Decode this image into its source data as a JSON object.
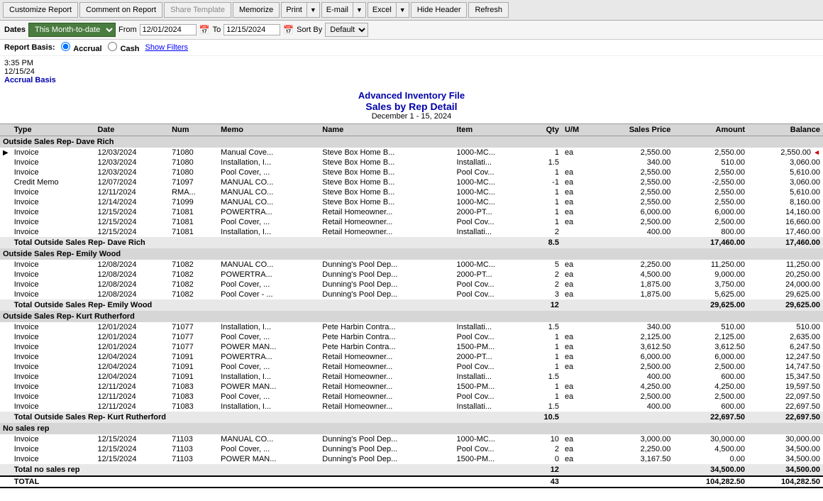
{
  "toolbar": {
    "customize_report": "Customize Report",
    "comment_on_report": "Comment on Report",
    "share_template": "Share Template",
    "memorize": "Memorize",
    "print": "Print",
    "email": "E-mail",
    "excel": "Excel",
    "hide_header": "Hide Header",
    "refresh": "Refresh"
  },
  "filter_bar": {
    "dates_label": "Dates",
    "date_range": "This Month-to-date",
    "from_label": "From",
    "from_date": "12/01/2024",
    "to_label": "To",
    "to_date": "12/15/2024",
    "sort_label": "Sort By",
    "sort_value": "Default"
  },
  "basis_bar": {
    "report_basis_label": "Report Basis:",
    "accrual_label": "Accrual",
    "cash_label": "Cash",
    "show_filters": "Show Filters"
  },
  "meta": {
    "time": "3:35 PM",
    "date": "12/15/24",
    "basis": "Accrual Basis"
  },
  "report_header": {
    "company": "Advanced Inventory File",
    "title": "Sales by Rep Detail",
    "dates": "December 1 - 15, 2024"
  },
  "columns": [
    "Type",
    "Date",
    "Num",
    "Memo",
    "Name",
    "Item",
    "Qty",
    "U/M",
    "Sales Price",
    "Amount",
    "Balance"
  ],
  "groups": [
    {
      "label": "Outside Sales Rep- Dave Rich",
      "rows": [
        {
          "type": "Invoice",
          "date": "12/03/2024",
          "num": "71080",
          "memo": "Manual Cove...",
          "name": "Steve Box Home B...",
          "item": "1000-MC...",
          "qty": "1",
          "um": "ea",
          "price": "2,550.00",
          "amount": "2,550.00",
          "balance": "2,550.00",
          "note": "◄"
        },
        {
          "type": "Invoice",
          "date": "12/03/2024",
          "num": "71080",
          "memo": "Installation, I...",
          "name": "Steve Box Home B...",
          "item": "Installati...",
          "qty": "1.5",
          "um": "",
          "price": "340.00",
          "amount": "510.00",
          "balance": "3,060.00",
          "note": ""
        },
        {
          "type": "Invoice",
          "date": "12/03/2024",
          "num": "71080",
          "memo": "Pool Cover, ...",
          "name": "Steve Box Home B...",
          "item": "Pool Cov...",
          "qty": "1",
          "um": "ea",
          "price": "2,550.00",
          "amount": "2,550.00",
          "balance": "5,610.00",
          "note": ""
        },
        {
          "type": "Credit Memo",
          "date": "12/07/2024",
          "num": "71097",
          "memo": "MANUAL CO...",
          "name": "Steve Box Home B...",
          "item": "1000-MC...",
          "qty": "-1",
          "um": "ea",
          "price": "2,550.00",
          "amount": "-2,550.00",
          "balance": "3,060.00",
          "note": ""
        },
        {
          "type": "Invoice",
          "date": "12/11/2024",
          "num": "RMA...",
          "memo": "MANUAL CO...",
          "name": "Steve Box Home B...",
          "item": "1000-MC...",
          "qty": "1",
          "um": "ea",
          "price": "2,550.00",
          "amount": "2,550.00",
          "balance": "5,610.00",
          "note": ""
        },
        {
          "type": "Invoice",
          "date": "12/14/2024",
          "num": "71099",
          "memo": "MANUAL CO...",
          "name": "Steve Box Home B...",
          "item": "1000-MC...",
          "qty": "1",
          "um": "ea",
          "price": "2,550.00",
          "amount": "2,550.00",
          "balance": "8,160.00",
          "note": ""
        },
        {
          "type": "Invoice",
          "date": "12/15/2024",
          "num": "71081",
          "memo": "POWERTRA...",
          "name": "Retail Homeowner...",
          "item": "2000-PT...",
          "qty": "1",
          "um": "ea",
          "price": "6,000.00",
          "amount": "6,000.00",
          "balance": "14,160.00",
          "note": ""
        },
        {
          "type": "Invoice",
          "date": "12/15/2024",
          "num": "71081",
          "memo": "Pool Cover, ...",
          "name": "Retail Homeowner...",
          "item": "Pool Cov...",
          "qty": "1",
          "um": "ea",
          "price": "2,500.00",
          "amount": "2,500.00",
          "balance": "16,660.00",
          "note": ""
        },
        {
          "type": "Invoice",
          "date": "12/15/2024",
          "num": "71081",
          "memo": "Installation, I...",
          "name": "Retail Homeowner...",
          "item": "Installati...",
          "qty": "2",
          "um": "",
          "price": "400.00",
          "amount": "800.00",
          "balance": "17,460.00",
          "note": ""
        }
      ],
      "total_qty": "8.5",
      "total_amount": "17,460.00",
      "total_balance": "17,460.00",
      "total_label": "Total Outside Sales Rep- Dave Rich"
    },
    {
      "label": "Outside Sales Rep- Emily Wood",
      "rows": [
        {
          "type": "Invoice",
          "date": "12/08/2024",
          "num": "71082",
          "memo": "MANUAL CO...",
          "name": "Dunning's Pool Dep...",
          "item": "1000-MC...",
          "qty": "5",
          "um": "ea",
          "price": "2,250.00",
          "amount": "11,250.00",
          "balance": "11,250.00",
          "note": ""
        },
        {
          "type": "Invoice",
          "date": "12/08/2024",
          "num": "71082",
          "memo": "POWERTRA...",
          "name": "Dunning's Pool Dep...",
          "item": "2000-PT...",
          "qty": "2",
          "um": "ea",
          "price": "4,500.00",
          "amount": "9,000.00",
          "balance": "20,250.00",
          "note": ""
        },
        {
          "type": "Invoice",
          "date": "12/08/2024",
          "num": "71082",
          "memo": "Pool Cover, ...",
          "name": "Dunning's Pool Dep...",
          "item": "Pool Cov...",
          "qty": "2",
          "um": "ea",
          "price": "1,875.00",
          "amount": "3,750.00",
          "balance": "24,000.00",
          "note": ""
        },
        {
          "type": "Invoice",
          "date": "12/08/2024",
          "num": "71082",
          "memo": "Pool Cover - ...",
          "name": "Dunning's Pool Dep...",
          "item": "Pool Cov...",
          "qty": "3",
          "um": "ea",
          "price": "1,875.00",
          "amount": "5,625.00",
          "balance": "29,625.00",
          "note": ""
        }
      ],
      "total_qty": "12",
      "total_amount": "29,625.00",
      "total_balance": "29,625.00",
      "total_label": "Total Outside Sales Rep- Emily Wood"
    },
    {
      "label": "Outside Sales Rep- Kurt Rutherford",
      "rows": [
        {
          "type": "Invoice",
          "date": "12/01/2024",
          "num": "71077",
          "memo": "Installation, I...",
          "name": "Pete Harbin Contra...",
          "item": "Installati...",
          "qty": "1.5",
          "um": "",
          "price": "340.00",
          "amount": "510.00",
          "balance": "510.00",
          "note": ""
        },
        {
          "type": "Invoice",
          "date": "12/01/2024",
          "num": "71077",
          "memo": "Pool Cover, ...",
          "name": "Pete Harbin Contra...",
          "item": "Pool Cov...",
          "qty": "1",
          "um": "ea",
          "price": "2,125.00",
          "amount": "2,125.00",
          "balance": "2,635.00",
          "note": ""
        },
        {
          "type": "Invoice",
          "date": "12/01/2024",
          "num": "71077",
          "memo": "POWER MAN...",
          "name": "Pete Harbin Contra...",
          "item": "1500-PM...",
          "qty": "1",
          "um": "ea",
          "price": "3,612.50",
          "amount": "3,612.50",
          "balance": "6,247.50",
          "note": ""
        },
        {
          "type": "Invoice",
          "date": "12/04/2024",
          "num": "71091",
          "memo": "POWERTRA...",
          "name": "Retail Homeowner...",
          "item": "2000-PT...",
          "qty": "1",
          "um": "ea",
          "price": "6,000.00",
          "amount": "6,000.00",
          "balance": "12,247.50",
          "note": ""
        },
        {
          "type": "Invoice",
          "date": "12/04/2024",
          "num": "71091",
          "memo": "Pool Cover, ...",
          "name": "Retail Homeowner...",
          "item": "Pool Cov...",
          "qty": "1",
          "um": "ea",
          "price": "2,500.00",
          "amount": "2,500.00",
          "balance": "14,747.50",
          "note": ""
        },
        {
          "type": "Invoice",
          "date": "12/04/2024",
          "num": "71091",
          "memo": "Installation, I...",
          "name": "Retail Homeowner...",
          "item": "Installati...",
          "qty": "1.5",
          "um": "",
          "price": "400.00",
          "amount": "600.00",
          "balance": "15,347.50",
          "note": ""
        },
        {
          "type": "Invoice",
          "date": "12/11/2024",
          "num": "71083",
          "memo": "POWER MAN...",
          "name": "Retail Homeowner...",
          "item": "1500-PM...",
          "qty": "1",
          "um": "ea",
          "price": "4,250.00",
          "amount": "4,250.00",
          "balance": "19,597.50",
          "note": ""
        },
        {
          "type": "Invoice",
          "date": "12/11/2024",
          "num": "71083",
          "memo": "Pool Cover, ...",
          "name": "Retail Homeowner...",
          "item": "Pool Cov...",
          "qty": "1",
          "um": "ea",
          "price": "2,500.00",
          "amount": "2,500.00",
          "balance": "22,097.50",
          "note": ""
        },
        {
          "type": "Invoice",
          "date": "12/11/2024",
          "num": "71083",
          "memo": "Installation, I...",
          "name": "Retail Homeowner...",
          "item": "Installati...",
          "qty": "1.5",
          "um": "",
          "price": "400.00",
          "amount": "600.00",
          "balance": "22,697.50",
          "note": ""
        }
      ],
      "total_qty": "10.5",
      "total_amount": "22,697.50",
      "total_balance": "22,697.50",
      "total_label": "Total Outside Sales Rep- Kurt Rutherford"
    },
    {
      "label": "No sales rep",
      "rows": [
        {
          "type": "Invoice",
          "date": "12/15/2024",
          "num": "71103",
          "memo": "MANUAL CO...",
          "name": "Dunning's Pool Dep...",
          "item": "1000-MC...",
          "qty": "10",
          "um": "ea",
          "price": "3,000.00",
          "amount": "30,000.00",
          "balance": "30,000.00",
          "note": ""
        },
        {
          "type": "Invoice",
          "date": "12/15/2024",
          "num": "71103",
          "memo": "Pool Cover, ...",
          "name": "Dunning's Pool Dep...",
          "item": "Pool Cov...",
          "qty": "2",
          "um": "ea",
          "price": "2,250.00",
          "amount": "4,500.00",
          "balance": "34,500.00",
          "note": ""
        },
        {
          "type": "Invoice",
          "date": "12/15/2024",
          "num": "71103",
          "memo": "POWER MAN...",
          "name": "Dunning's Pool Dep...",
          "item": "1500-PM...",
          "qty": "0",
          "um": "ea",
          "price": "3,167.50",
          "amount": "0.00",
          "balance": "34,500.00",
          "note": ""
        }
      ],
      "total_qty": "12",
      "total_amount": "34,500.00",
      "total_balance": "34,500.00",
      "total_label": "Total no sales rep"
    }
  ],
  "grand_total": {
    "label": "TOTAL",
    "qty": "43",
    "amount": "104,282.50",
    "balance": "104,282.50"
  }
}
